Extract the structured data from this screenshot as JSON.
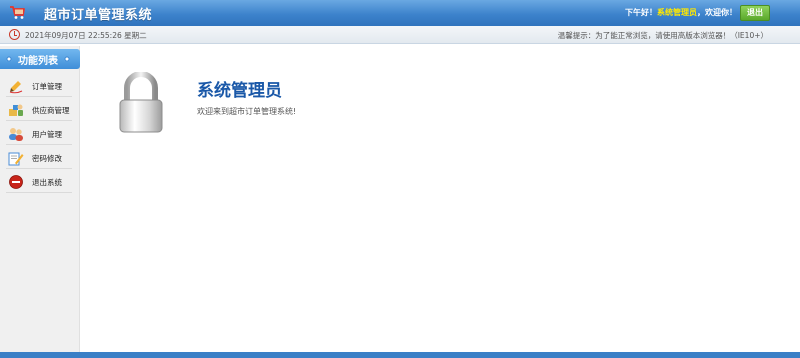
{
  "header": {
    "title": "超市订单管理系统",
    "greeting_prefix": "下午好！",
    "username": "系统管理员",
    "greeting_suffix": "，欢迎你！",
    "logout_label": "退出",
    "logo_icon": "shopping-cart-icon"
  },
  "subbar": {
    "datetime": "2021年09月07日 22:55:26 星期二",
    "tip": "温馨提示：为了能正常浏览，请使用高版本浏览器！（IE10+）"
  },
  "sidebar": {
    "heading": "功能列表",
    "items": [
      {
        "label": "订单管理",
        "icon": "order-icon"
      },
      {
        "label": "供应商管理",
        "icon": "supplier-icon"
      },
      {
        "label": "用户管理",
        "icon": "users-icon"
      },
      {
        "label": "密码修改",
        "icon": "password-edit-icon"
      },
      {
        "label": "退出系统",
        "icon": "exit-icon"
      }
    ]
  },
  "main": {
    "title": "系统管理员",
    "message": "欢迎来到超市订单管理系统!"
  },
  "colors": {
    "header": "#3d83cc",
    "accent_title": "#1a58a8",
    "username": "#ffe800",
    "logout": "#5aa82b"
  }
}
